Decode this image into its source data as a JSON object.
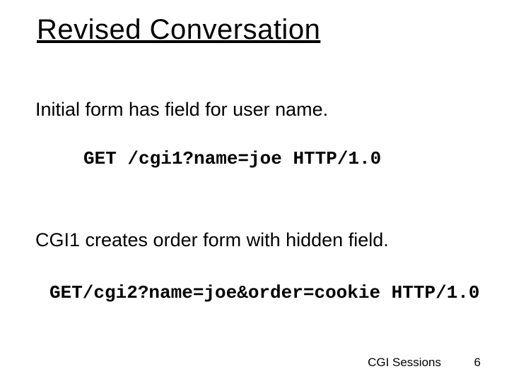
{
  "title": "Revised Conversation",
  "body": {
    "line1": "Initial form has field for user name.",
    "line2": "CGI1 creates order form with hidden field."
  },
  "code": {
    "request1": "GET /cgi1?name=joe HTTP/1.0",
    "request2": "GET/cgi2?name=joe&order=cookie HTTP/1.0"
  },
  "footer": {
    "label": "CGI Sessions",
    "page_number": "6"
  }
}
